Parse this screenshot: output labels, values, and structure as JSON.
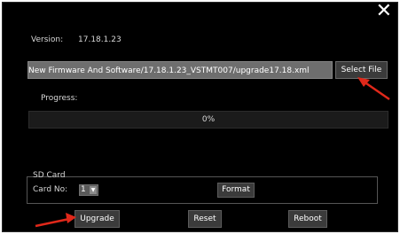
{
  "dialog": {
    "close_label": "✕"
  },
  "version": {
    "label": "Version:",
    "value": "17.18.1.23"
  },
  "firmware": {
    "file_path": "New Firmware And Software/17.18.1.23_VSTMT007/upgrade17.18.xml",
    "select_file_label": "Select File"
  },
  "progress": {
    "label": "Progress:",
    "value_text": "0%",
    "fraction": 0
  },
  "sd_card": {
    "title": "SD Card",
    "card_no_label": "Card No:",
    "card_no_value": "1",
    "format_label": "Format"
  },
  "actions": {
    "upgrade_label": "Upgrade",
    "reset_label": "Reset",
    "reboot_label": "Reboot"
  },
  "colors": {
    "annotation_arrow": "#e0281a",
    "background": "#000000",
    "button": "#3b3b3b"
  }
}
